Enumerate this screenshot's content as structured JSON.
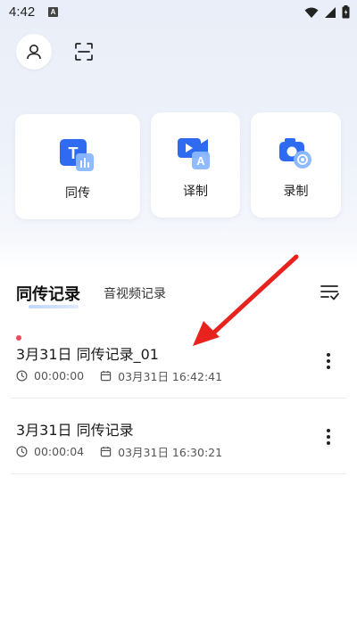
{
  "status_bar": {
    "time": "4:42",
    "notification_badge": "A"
  },
  "header": {
    "profile_icon": "person-icon",
    "scan_icon": "scan-icon"
  },
  "features": [
    {
      "label": "同传",
      "icon": "simultaneous-interpretation-icon",
      "icon_letter": "T"
    },
    {
      "label": "译制",
      "icon": "video-translation-icon",
      "icon_letter": "A"
    },
    {
      "label": "录制",
      "icon": "recording-camera-icon"
    }
  ],
  "tabs": {
    "active": "同传记录",
    "inactive": "音视频记录"
  },
  "records": [
    {
      "title": "3月31日 同传记录_01",
      "duration": "00:00:00",
      "datetime": "03月31日 16:42:41",
      "unread": true
    },
    {
      "title": "3月31日 同传记录",
      "duration": "00:00:04",
      "datetime": "03月31日 16:30:21",
      "unread": false
    }
  ],
  "colors": {
    "accent_blue": "#2f6bf0",
    "light_blue": "#7fb0ff",
    "annotation_red": "#e8231d",
    "unread_dot": "#ef4a5a"
  }
}
